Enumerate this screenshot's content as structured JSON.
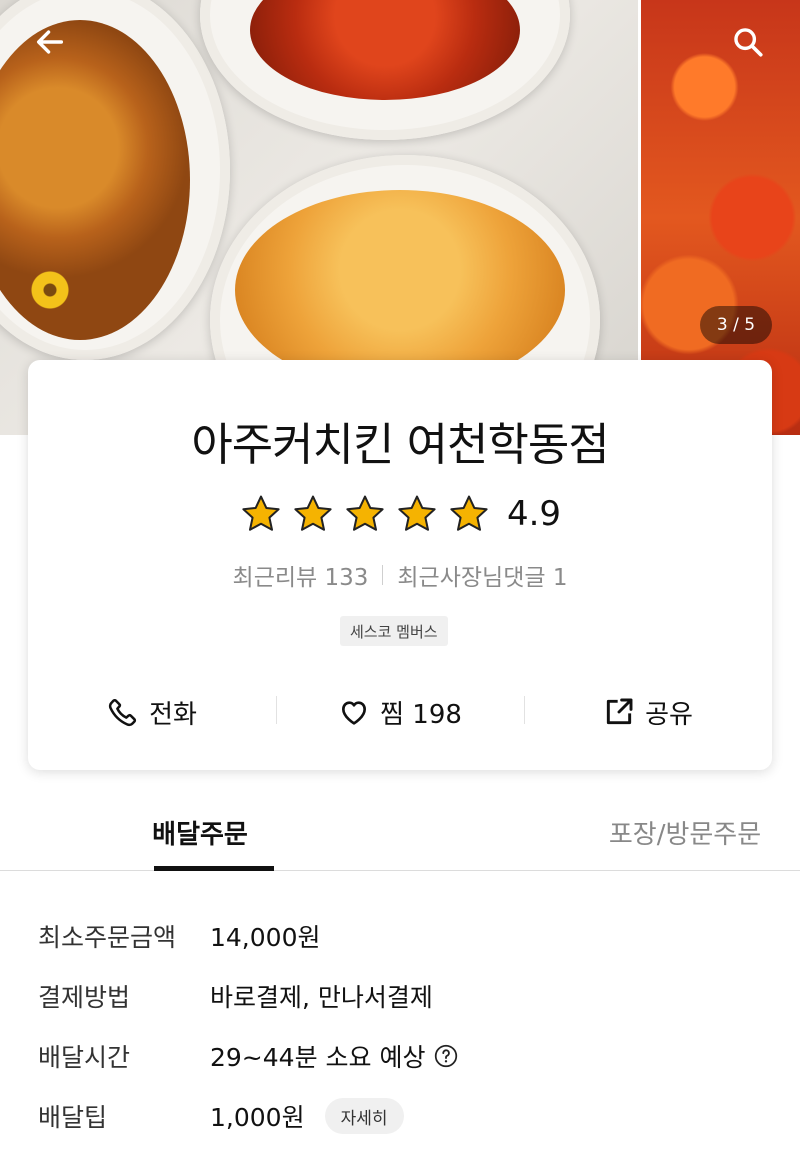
{
  "hero": {
    "image_counter": "3 / 5",
    "back_icon": "arrow-left-icon",
    "search_icon": "search-icon"
  },
  "store": {
    "name": "아주커치킨 여천학동점",
    "rating": "4.9",
    "star_count": 5,
    "recent_reviews": "최근리뷰 133",
    "recent_owner_comments": "최근사장님댓글 1",
    "badge": "세스코 멤버스"
  },
  "actions": {
    "call_label": "전화",
    "favorite_label": "찜 198",
    "share_label": "공유"
  },
  "tabs": [
    {
      "label": "배달주문",
      "active": true
    },
    {
      "label": "포장/방문주문",
      "active": false
    }
  ],
  "info": {
    "min_order": {
      "label": "최소주문금액",
      "value": "14,000원"
    },
    "payment": {
      "label": "결제방법",
      "value": "바로결제, 만나서결제"
    },
    "delivery_time": {
      "label": "배달시간",
      "value": "29~44분 소요 예상"
    },
    "delivery_tip": {
      "label": "배달팁",
      "value": "1,000원",
      "detail_button": "자세히"
    }
  },
  "colors": {
    "star": "#f5b301",
    "text": "#111111",
    "muted": "#8a8a8a"
  }
}
